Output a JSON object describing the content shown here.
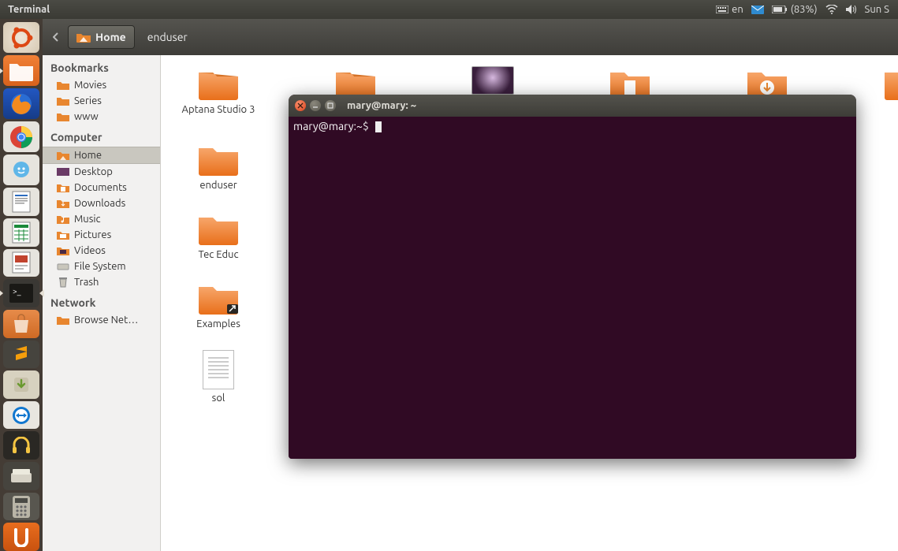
{
  "top_panel": {
    "app_name": "Terminal",
    "keyboard": "en",
    "battery": "(83%)",
    "clock": "Sun S"
  },
  "launcher_icons": [
    "ubuntu-dash",
    "nautilus",
    "firefox",
    "chrome",
    "empathy",
    "libreoffice-writer",
    "libreoffice-calc",
    "libreoffice-impress",
    "terminal",
    "software-center",
    "sublime",
    "downloads",
    "teamviewer",
    "audio-app",
    "scanner",
    "calculator",
    "ubuntu-one"
  ],
  "path_bar": {
    "home": "Home",
    "sub": "enduser"
  },
  "sidebar": {
    "bookmarks_title": "Bookmarks",
    "bookmarks": [
      "Movies",
      "Series",
      "www"
    ],
    "computer_title": "Computer",
    "computer": [
      "Home",
      "Desktop",
      "Documents",
      "Downloads",
      "Music",
      "Pictures",
      "Videos",
      "File System",
      "Trash"
    ],
    "network_title": "Network",
    "network": [
      "Browse Net…"
    ]
  },
  "files_row1": [
    "Aptana Studio 3",
    "",
    "",
    "",
    "",
    ""
  ],
  "files_col": [
    "Aptana Studio 3",
    "enduser",
    "Tec Educ",
    "Examples",
    "sol"
  ],
  "terminal": {
    "title": "mary@mary: ~",
    "prompt_user": "mary@mary",
    "prompt_sep": ":",
    "prompt_path": "~",
    "prompt_end": "$"
  }
}
